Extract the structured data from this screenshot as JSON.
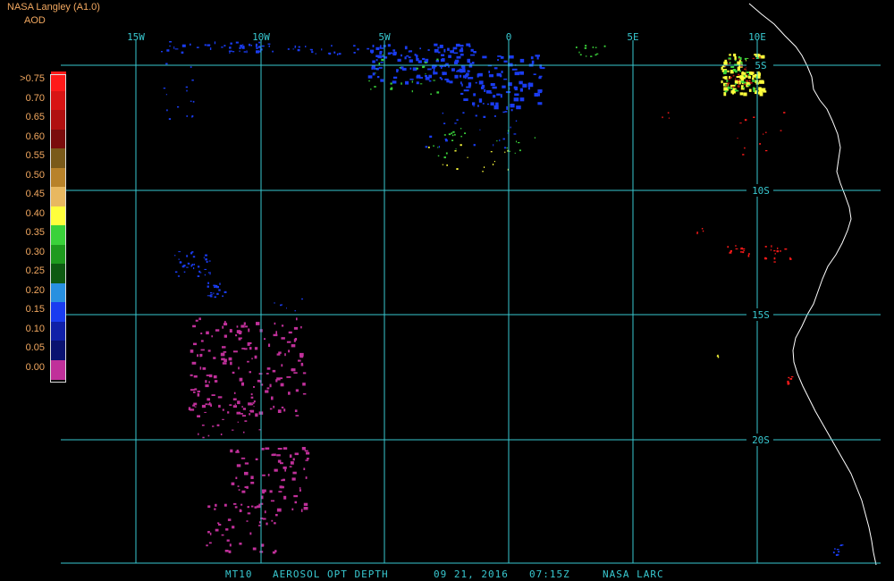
{
  "header": {
    "source": "NASA Langley (A1.0)",
    "variable": "AOD"
  },
  "map": {
    "grid_color": "#38c8d0",
    "coast_color": "#ffffff",
    "longitude_labels": [
      "15W",
      "10W",
      "5W",
      "0",
      "5E",
      "10E"
    ],
    "latitude_labels": [
      "5S",
      "10S",
      "15S",
      "20S"
    ],
    "aerosol_colors": {
      "magenta": "#c0309a",
      "blue": "#1a3cf0",
      "green": "#3ad23a",
      "yellow": "#ffff3c",
      "red": "#ff1a1a",
      "dark_red": "#b01010"
    }
  },
  "legend": {
    "entries": [
      {
        "label": ">0.75",
        "color": "#ff1a1a"
      },
      {
        "label": "0.70",
        "color": "#d81414"
      },
      {
        "label": "0.65",
        "color": "#b01010"
      },
      {
        "label": "0.60",
        "color": "#7a0c0c"
      },
      {
        "label": "0.55",
        "color": "#7a5a1a"
      },
      {
        "label": "0.50",
        "color": "#b8822a"
      },
      {
        "label": "0.45",
        "color": "#e8b860"
      },
      {
        "label": "0.40",
        "color": "#ffff3c"
      },
      {
        "label": "0.35",
        "color": "#3ad23a"
      },
      {
        "label": "0.30",
        "color": "#1e9a1e"
      },
      {
        "label": "0.25",
        "color": "#0e5a12"
      },
      {
        "label": "0.20",
        "color": "#2890e0"
      },
      {
        "label": "0.15",
        "color": "#1a3cf0"
      },
      {
        "label": "0.10",
        "color": "#1020a8"
      },
      {
        "label": "0.05",
        "color": "#0a1270"
      },
      {
        "label": "0.00",
        "color": "#c0309a"
      }
    ]
  },
  "caption": {
    "satellite": "MT10",
    "product": "AEROSOL OPT DEPTH",
    "date": "09 21, 2016",
    "time": "07:15Z",
    "agency": "NASA LARC"
  }
}
